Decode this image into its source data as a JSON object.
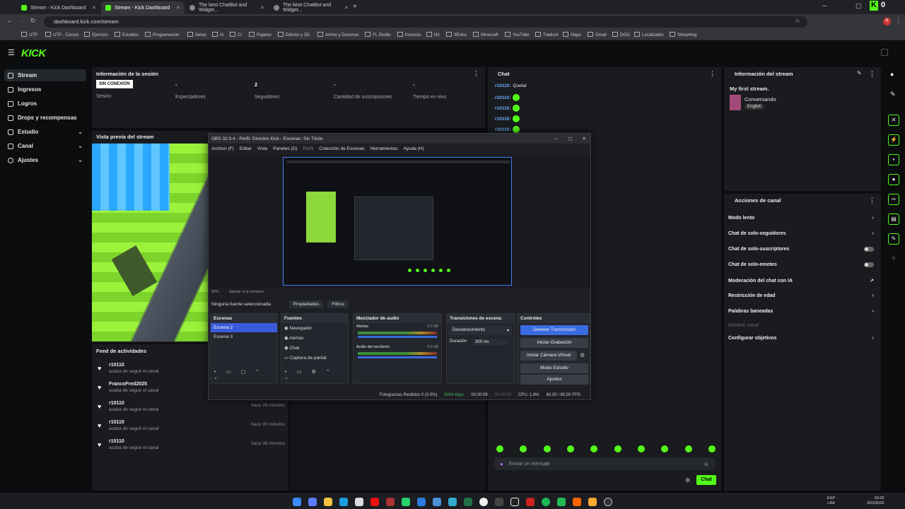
{
  "browser": {
    "tabs": [
      {
        "title": "Stream - Kick Dashboard",
        "active": false
      },
      {
        "title": "Stream - Kick Dashboard",
        "active": true
      },
      {
        "title": "The best ChatBot and Widget...",
        "active": false
      },
      {
        "title": "The best ChatBot and Widget...",
        "active": false
      }
    ],
    "url": "dashboard.kick.com/stream",
    "bookmarks": [
      "UTP",
      "UTP - Cursos",
      "Ejercicio",
      "Estudios",
      "Programacion",
      "Setup",
      "IA",
      "CI",
      "Pajareo",
      "Edicion y 3D",
      "Anime y Doramas",
      "FL Studio",
      "Konecta",
      "N2",
      "3Entra",
      "Minecraft",
      "YouTube",
      "Traducir",
      "Maps",
      "Gmail",
      "DGO",
      "Localizador",
      "Streaming"
    ]
  },
  "kick": {
    "logo": "KICK",
    "sidebar": [
      {
        "label": "Stream",
        "active": true,
        "chevron": false
      },
      {
        "label": "Ingresos",
        "active": false,
        "chevron": false
      },
      {
        "label": "Logros",
        "active": false,
        "chevron": false
      },
      {
        "label": "Drops y recompensas",
        "active": false,
        "chevron": false
      },
      {
        "label": "Estudio",
        "active": false,
        "chevron": true
      },
      {
        "label": "Canal",
        "active": false,
        "chevron": true
      },
      {
        "label": "Ajustes",
        "active": false,
        "chevron": true
      }
    ],
    "session": {
      "title": "Información de la sesión",
      "offline_badge": "SIN CONEXIÓN",
      "stats": [
        {
          "value": "",
          "label": "Sesión"
        },
        {
          "value": "-",
          "label": "Espectadores"
        },
        {
          "value": "2",
          "label": "Seguidores"
        },
        {
          "value": "-",
          "label": "Cantidad de suscripciones"
        },
        {
          "value": "-",
          "label": "Tiempo en vivo"
        }
      ]
    },
    "preview": {
      "title": "Vista previa del stream"
    },
    "feed": {
      "title": "Feed de actividades",
      "items": [
        {
          "name": "r10110",
          "desc": "acaba de seguir el canal",
          "time": ""
        },
        {
          "name": "FrancoFred2025",
          "desc": "acaba de seguir el canal",
          "time": ""
        },
        {
          "name": "r10110",
          "desc": "acaba de seguir el canal",
          "time": "hace 29 minutos"
        },
        {
          "name": "r10110",
          "desc": "acaba de seguir el canal",
          "time": "hace 30 minutos"
        },
        {
          "name": "r10110",
          "desc": "acaba de seguir el canal",
          "time": "hace 36 minutos"
        }
      ]
    },
    "chat": {
      "title": "Chat",
      "messages": [
        {
          "user": "r10110:",
          "text": "Quetal"
        },
        {
          "user": "r10110:",
          "text": ""
        },
        {
          "user": "r10110:",
          "text": ""
        },
        {
          "user": "r10110:",
          "text": ""
        },
        {
          "user": "r10110:",
          "text": ""
        }
      ],
      "placeholder": "Enviar un mensaje",
      "send_label": "Chat"
    },
    "stream_info": {
      "title": "Información del stream",
      "stream_title": "My first stream.",
      "category": "Conversando",
      "language": "English"
    },
    "channel_actions": {
      "title": "Acciones de canal",
      "items": [
        {
          "label": "Modo lento",
          "control": "chevron"
        },
        {
          "label": "Chat de solo-seguidores",
          "control": "chevron"
        },
        {
          "label": "Chat de solo-suscriptores",
          "control": "toggle"
        },
        {
          "label": "Chat de solo-emotes",
          "control": "toggle"
        },
        {
          "label": "Moderación del chat con IA",
          "control": "external"
        },
        {
          "label": "Restricción de edad",
          "control": "chevron"
        },
        {
          "label": "Palabras baneadas",
          "control": "chevron"
        },
        {
          "label": "Hostear canal",
          "control": "disabled"
        },
        {
          "label": "Configurar objetivos",
          "control": "chevron"
        }
      ]
    }
  },
  "obs": {
    "title": "OBS 32.0.4 - Perfil: Directos Kick - Escenas: Sin Título",
    "menu": [
      "Archivo (F)",
      "Editar",
      "Vista",
      "Paneles (D)",
      "Perfil",
      "Colección de Escenas",
      "Herramientas",
      "Ayuda (H)"
    ],
    "zoom": "50%",
    "fit": "Ajustar a la ventana",
    "no_source": "Ninguna fuente seleccionada",
    "properties": "Propiedades",
    "filters": "Filtros",
    "scenes": {
      "title": "Escenas",
      "items": [
        "Escena 2",
        "Escena 3"
      ]
    },
    "sources": {
      "title": "Fuentes",
      "items": [
        "Navegador",
        "Alertas",
        "Chat",
        "Captura de pantal"
      ]
    },
    "mixer": {
      "title": "Mezclador de audio",
      "channels": [
        {
          "name": "Alertas",
          "db": "0.0 dB"
        },
        {
          "name": "Audio del escritorio",
          "db": "0.0 dB"
        }
      ]
    },
    "transitions": {
      "title": "Transiciones de escena",
      "selected": "Desvanecimiento",
      "duration_label": "Duración",
      "duration": "300 ms"
    },
    "controls": {
      "title": "Controles",
      "buttons": [
        "Detener Transmisión",
        "Iniciar Grabación",
        "Iniciar Cámara Virtual",
        "Modo Estudio",
        "Ajustes"
      ]
    },
    "status": {
      "dropped": "Fotogramas Perdidos 0 (0.0%)",
      "kbps": "6064 kbps",
      "time1": "00:00:09",
      "time2": "00:00:00",
      "cpu": "CPU: 1.8%",
      "fps": "60.00 / 60.00 FPS"
    }
  },
  "taskbar": {
    "lang": "ESP",
    "lang2": "LAA",
    "time": "03:25",
    "date": "3/01/2026"
  }
}
